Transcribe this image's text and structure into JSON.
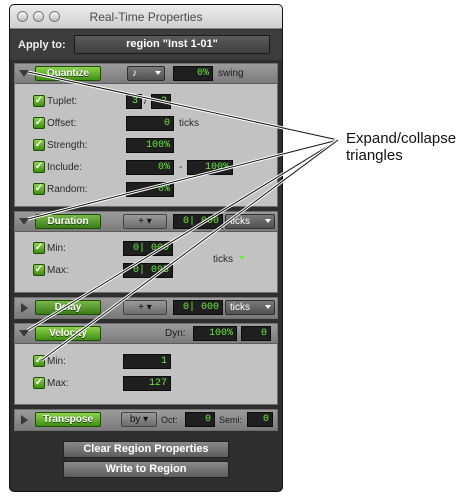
{
  "window": {
    "title": "Real-Time Properties"
  },
  "apply": {
    "label": "Apply to:",
    "value": "region \"Inst 1-01\""
  },
  "quantize": {
    "button": "Quantize",
    "note_icon": "eighth-note-icon",
    "swing_value": "0%",
    "swing_label": "swing",
    "rows": [
      {
        "label": "Tuplet:",
        "value1": "3",
        "sep": "/",
        "value2": "2"
      },
      {
        "label": "Offset:",
        "value": "0",
        "unit": "ticks"
      },
      {
        "label": "Strength:",
        "value": "100%"
      },
      {
        "label": "Include:",
        "value1": "0%",
        "sep": "-",
        "value2": "100%"
      },
      {
        "label": "Random:",
        "value": "0%"
      }
    ]
  },
  "duration": {
    "button": "Duration",
    "op": "+",
    "value": "0| 000",
    "unit": "ticks",
    "rows": [
      {
        "label": "Min:",
        "value": "0| 000"
      },
      {
        "label": "Max:",
        "value": "0| 095"
      }
    ],
    "side_unit": "ticks"
  },
  "delay": {
    "button": "Delay",
    "op": "+",
    "value": "0| 000",
    "unit": "ticks"
  },
  "velocity": {
    "button": "Velocity",
    "dyn_label": "Dyn:",
    "dyn_value": "100%",
    "dyn_offset": "0",
    "rows": [
      {
        "label": "Min:",
        "value": "1"
      },
      {
        "label": "Max:",
        "value": "127"
      }
    ]
  },
  "transpose": {
    "button": "Transpose",
    "mode": "by",
    "oct_label": "Oct:",
    "oct_value": "0",
    "semi_label": "Semi:",
    "semi_value": "0"
  },
  "actions": {
    "clear": "Clear Region Properties",
    "write": "Write to Region"
  },
  "callout": {
    "line1": "Expand/collapse",
    "line2": "triangles"
  }
}
